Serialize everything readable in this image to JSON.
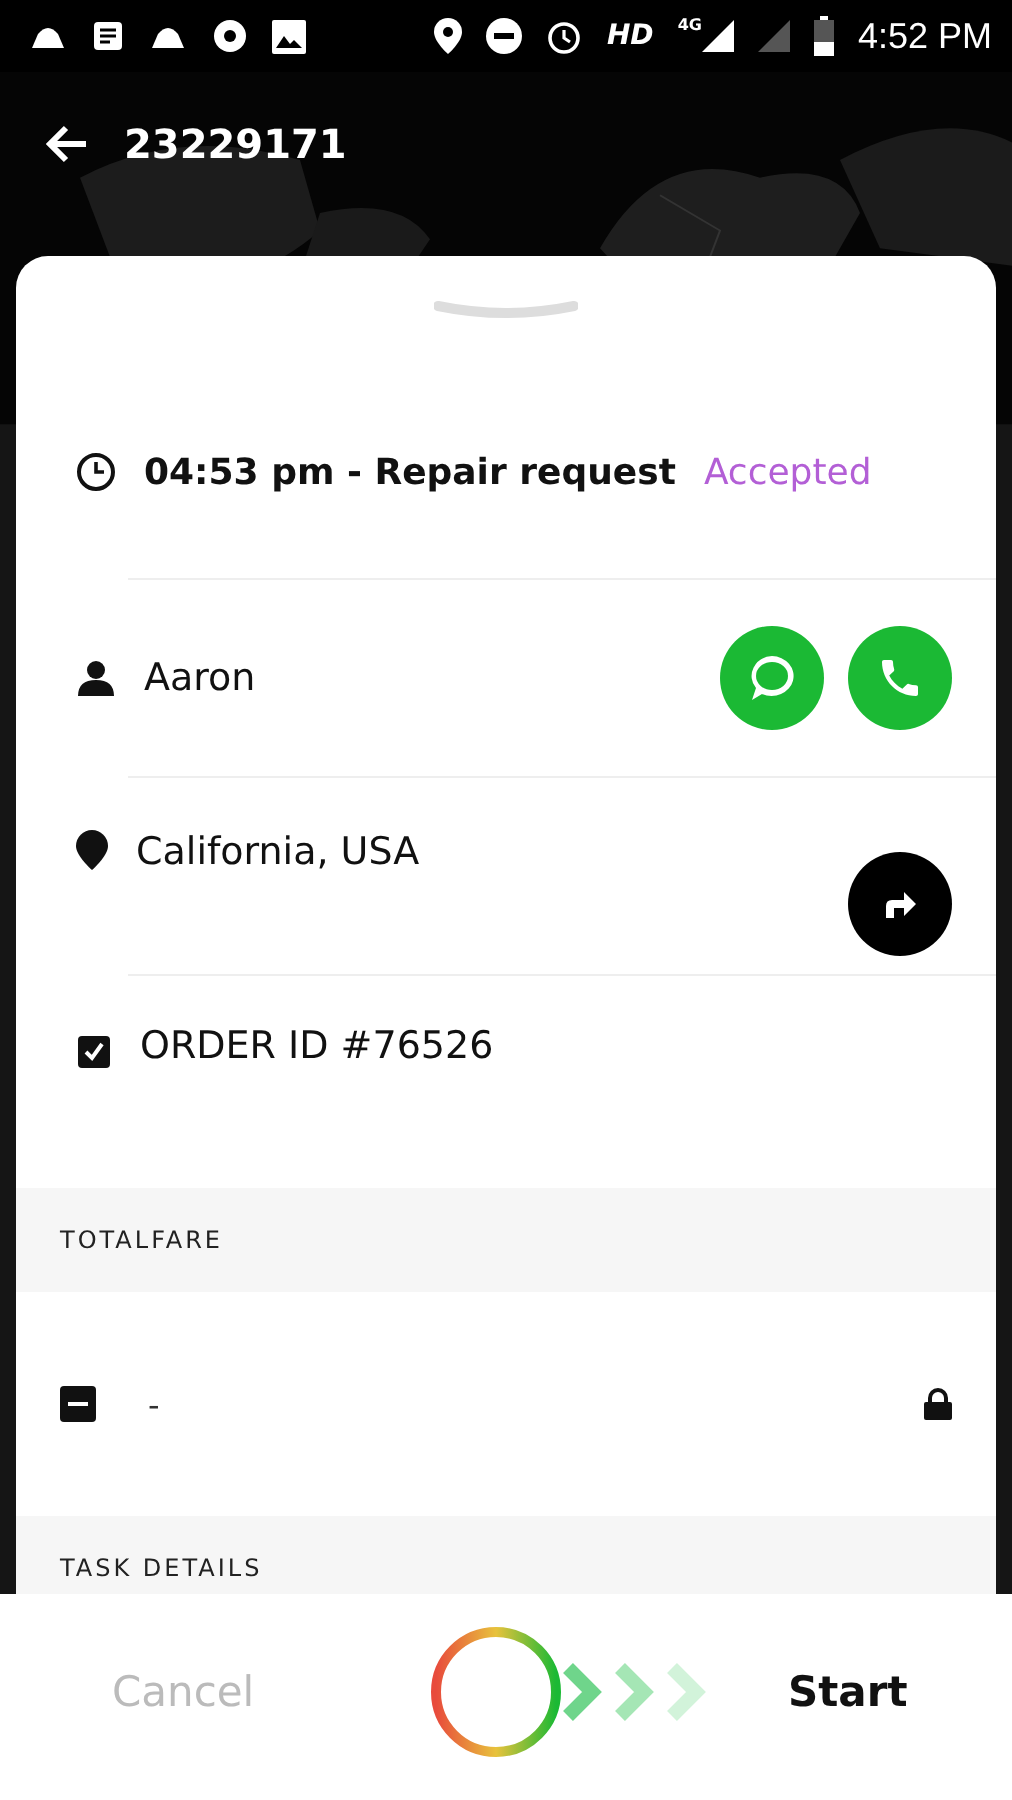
{
  "status_bar": {
    "network": "HD",
    "signal": "4G",
    "time": "4:52 PM"
  },
  "app_bar": {
    "title": "23229171"
  },
  "job": {
    "time_title": "04:53 pm - Repair request",
    "status": "Accepted",
    "customer": "Aaron",
    "location": "California, USA",
    "order_id": "ORDER ID #76526"
  },
  "sections": [
    {
      "heading": "TOTALFARE",
      "value": "-"
    },
    {
      "heading": "TASK DETAILS"
    }
  ],
  "actions": {
    "cancel": "Cancel",
    "start": "Start"
  },
  "slider": {
    "level": 0
  }
}
